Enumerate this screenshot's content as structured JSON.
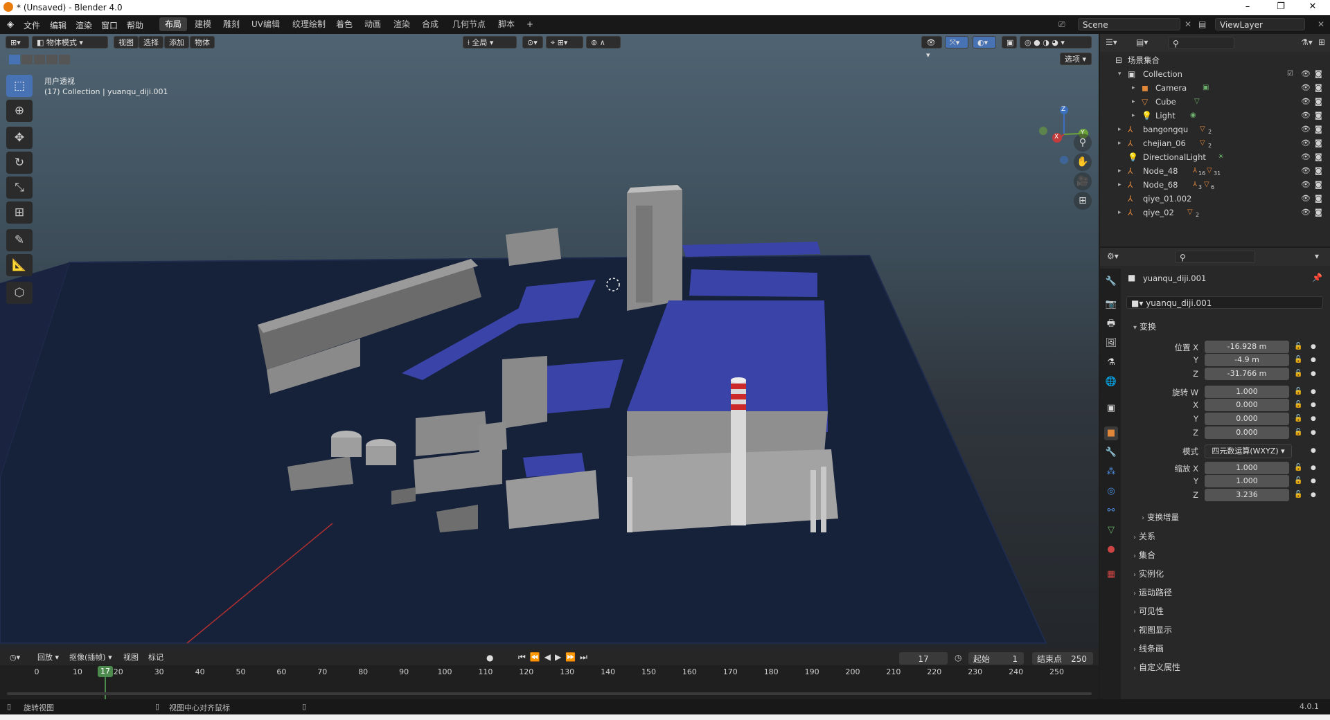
{
  "window": {
    "title": "* (Unsaved) - Blender 4.0",
    "minimize": "–",
    "maximize": "❐",
    "close": "✕"
  },
  "menu": [
    "文件",
    "编辑",
    "渲染",
    "窗口",
    "帮助"
  ],
  "workspaces": [
    "布局",
    "建模",
    "雕刻",
    "UV编辑",
    "纹理绘制",
    "着色",
    "动画",
    "渲染",
    "合成",
    "几何节点",
    "脚本"
  ],
  "active_workspace": "布局",
  "add_workspace": "+",
  "scene": {
    "name": "Scene",
    "viewlayer": "ViewLayer"
  },
  "viewport": {
    "mode": "物体模式",
    "header_menus": [
      "视图",
      "选择",
      "添加",
      "物体"
    ],
    "transform_orientation": "全局",
    "options": "选项",
    "view_name": "用户透视",
    "collection_info": "(17) Collection | yuanqu_diji.001",
    "gizmo": {
      "z": "Z",
      "y": "Y",
      "x": "X"
    }
  },
  "outliner": {
    "search_placeholder": "",
    "scene_collection": "场景集合",
    "rows": [
      {
        "name": "Collection",
        "type": "collection"
      },
      {
        "name": "Camera",
        "type": "camera"
      },
      {
        "name": "Cube",
        "type": "mesh"
      },
      {
        "name": "Light",
        "type": "light"
      },
      {
        "name": "bangongqu",
        "type": "empty",
        "badge": "2"
      },
      {
        "name": "chejian_06",
        "type": "empty",
        "badge": "2"
      },
      {
        "name": "DirectionalLight",
        "type": "light"
      },
      {
        "name": "Node_48",
        "type": "empty",
        "badge": "16",
        "badge2": "31"
      },
      {
        "name": "Node_68",
        "type": "empty",
        "badge": "3",
        "badge2": "6"
      },
      {
        "name": "qiye_01.002",
        "type": "empty"
      },
      {
        "name": "qiye_02",
        "type": "empty",
        "badge": "2"
      }
    ]
  },
  "properties": {
    "object_name": "yuanqu_diji.001",
    "object_field": "yuanqu_diji.001",
    "transform_label": "变换",
    "location": {
      "label": "位置 X",
      "x": "-16.928 m",
      "y": "-4.9 m",
      "z": "-31.766 m"
    },
    "rotation": {
      "label": "旋转 W",
      "w": "1.000",
      "x": "0.000",
      "y": "0.000",
      "z": "0.000"
    },
    "mode": {
      "label": "模式",
      "value": "四元数运算(WXYZ)"
    },
    "scale": {
      "label": "缩放 X",
      "x": "1.000",
      "y": "1.000",
      "z": "3.236"
    },
    "axis": {
      "y": "Y",
      "x": "X",
      "z": "Z"
    },
    "delta": "变换增量",
    "sections": [
      "关系",
      "集合",
      "实例化",
      "运动路径",
      "可见性",
      "视图显示",
      "线条画",
      "自定义属性"
    ]
  },
  "timeline": {
    "menus": [
      "回放",
      "抠像(插帧)",
      "视图",
      "标记"
    ],
    "current_frame": "17",
    "start_label": "起始",
    "start": "1",
    "end_label": "结束点",
    "end": "250",
    "ticks": [
      "0",
      "10",
      "20",
      "30",
      "40",
      "50",
      "60",
      "70",
      "80",
      "90",
      "100",
      "110",
      "120",
      "130",
      "140",
      "150",
      "160",
      "170",
      "180",
      "190",
      "200",
      "210",
      "220",
      "230",
      "240",
      "250"
    ],
    "playhead": "17"
  },
  "status": {
    "left": "旋转视图",
    "mid": "视图中心对齐鼠标",
    "version": "4.0.1"
  },
  "colors": {
    "accent": "#4772b3",
    "roof": "#3a43a8",
    "ground": "#17223a",
    "active_tab": "#3d3d3d"
  }
}
